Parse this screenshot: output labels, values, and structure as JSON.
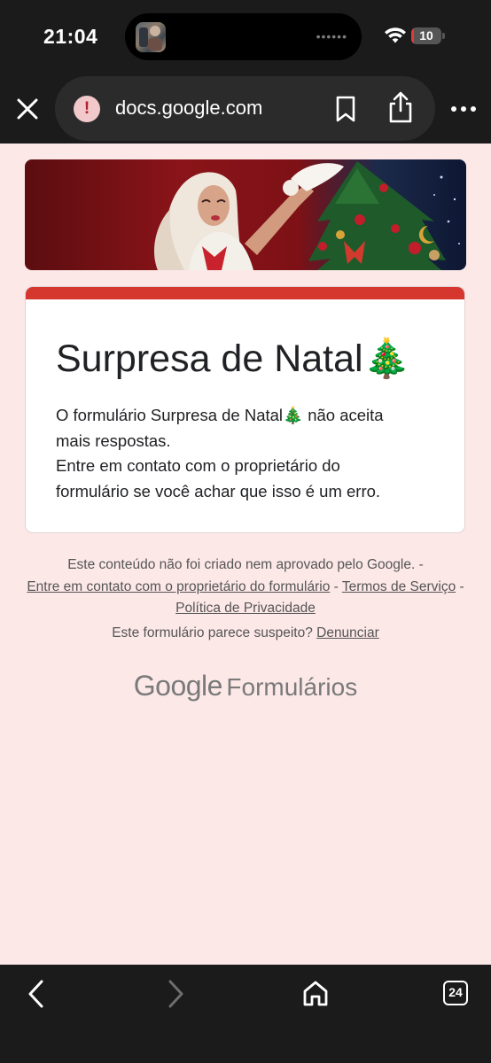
{
  "status_bar": {
    "time": "21:04",
    "battery": "10",
    "battery_fraction": 0.1,
    "island_dots": "••••••"
  },
  "browser": {
    "url": "docs.google.com",
    "warning_glyph": "!",
    "tab_count": "24"
  },
  "form": {
    "title": "Surpresa de Natal🎄",
    "message_lines": [
      "O formulário Surpresa de Natal🎄 não aceita",
      "mais respostas.",
      "Entre em contato com o proprietário do",
      "formulário se você achar que isso é um erro."
    ],
    "accent_color": "#d5362e"
  },
  "footer": {
    "disclaimer": "Este conteúdo não foi criado nem aprovado pelo Google. -",
    "contact_owner": "Entre em contato com o proprietário do formulário",
    "sep1": " - ",
    "terms": "Termos de Serviço",
    "sep2": " - ",
    "privacy": "Política de Privacidade",
    "suspicious": "Este formulário parece suspeito?",
    "report": "Denunciar",
    "brand_google": "Google",
    "brand_forms": "Formulários"
  },
  "colors": {
    "page_bg": "#fde8e8",
    "chrome_bg": "#1b1b1b"
  }
}
